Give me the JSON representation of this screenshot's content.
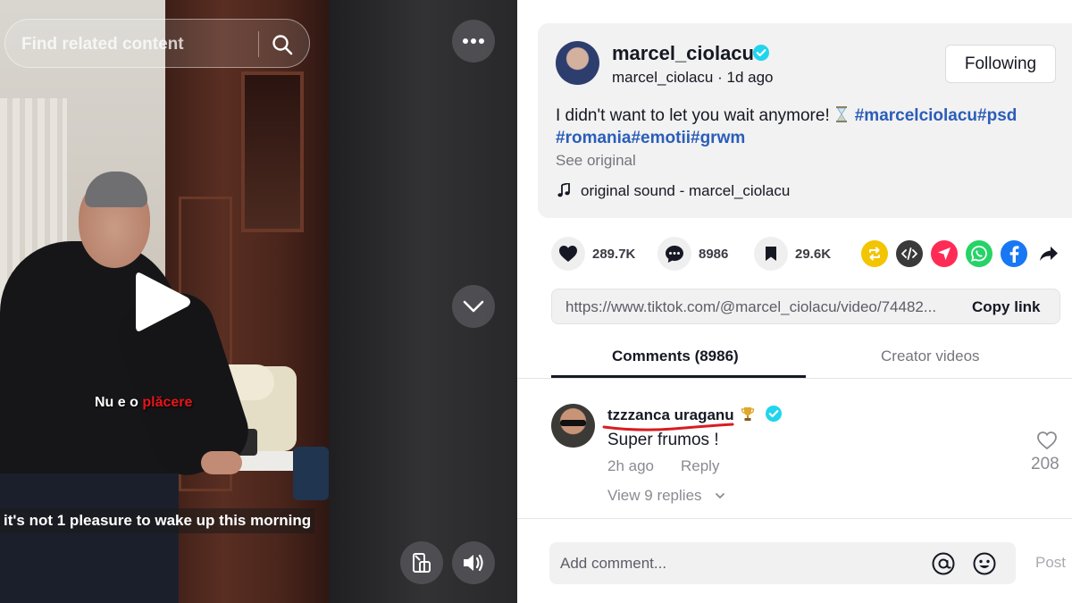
{
  "video": {
    "search_placeholder": "Find related content",
    "overlay_text_white": "Nu e o ",
    "overlay_text_red": "plăcere",
    "subtitle": "it's not 1 pleasure to wake up this morning"
  },
  "author": {
    "username": "marcel_ciolacu",
    "handle_time": "marcel_ciolacu · 1d ago",
    "follow_label": "Following"
  },
  "post": {
    "caption_text": "I didn't want to let you wait anymore!",
    "hashtags_line1": "#marcelciolacu#psd",
    "hashtags_line2": "#romania#emotii#grwm",
    "see_original": "See original",
    "sound": "original sound - marcel_ciolacu"
  },
  "actions": {
    "likes": "289.7K",
    "comments": "8986",
    "saves": "29.6K"
  },
  "share": {
    "link": "https://www.tiktok.com/@marcel_ciolacu/video/74482...",
    "copy_label": "Copy link"
  },
  "tabs": {
    "comments": "Comments (8986)",
    "creator": "Creator videos"
  },
  "comment": {
    "user": "tzzzanca uraganu",
    "text": "Super frumos !",
    "time": "2h ago",
    "reply": "Reply",
    "view_replies": "View 9 replies",
    "likes": "208"
  },
  "composer": {
    "placeholder": "Add comment...",
    "post_label": "Post"
  },
  "colors": {
    "hashtag": "#2b5db9",
    "verified": "#20d5ec",
    "like_red": "#fe2c55",
    "underline_annotation": "#d81c22"
  }
}
